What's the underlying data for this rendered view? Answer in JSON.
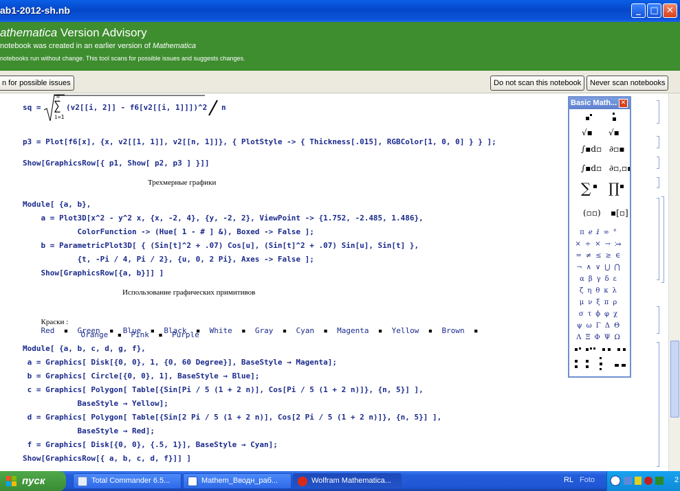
{
  "window": {
    "title": "ab1-2012-sh.nb"
  },
  "advisory": {
    "title_italic": "athematica",
    "title_rest": " Version Advisory",
    "line1_prefix": "notebook was created in an earlier version of ",
    "line1_italic": "Mathematica",
    "line2": "notebooks run without change. This tool scans for possible issues and suggests changes."
  },
  "buttons": {
    "scan": "n for possible issues",
    "do_not_scan": "Do not scan this notebook",
    "never_scan": "Never scan notebooks"
  },
  "code": {
    "sq": "sq = ",
    "sq_sum": "(v2[[i, 2]] - f6[v2[[i, 1]]])^2",
    "sq_div": "n",
    "sum_top": "n",
    "sum_bottom": "i=1",
    "p3": "p3 = Plot[f6[x], {x, v2[[1, 1]], v2[[n, 1]]}, { PlotStyle -> { Thickness[.015], RGBColor[1, 0, 0] } } ];",
    "show1": "Show[GraphicsRow[{ p1, Show[ p2, p3 ] }]]",
    "heading3d": "Трехмерные графики",
    "mod1_l1": "Module[ {a, b},",
    "mod1_l2": "    a = Plot3D[x^2 - y^2 x, {x, -2, 4}, {y, -2, 2}, ViewPoint -> {1.752, -2.485, 1.486},",
    "mod1_l3": "            ColorFunction -> (Hue[ 1 - # ] &), Boxed -> False ];",
    "mod1_l4": "    b = ParametricPlot3D[ { (Sin[t]^2 + .07) Cos[u], (Sin[t]^2 + .07) Sin[u], Sin[t] },",
    "mod1_l5": "            {t, -Pi / 4, Pi / 2}, {u, 0, 2 Pi}, Axes -> False ];",
    "mod1_l6": "    Show[GraphicsRow[{a, b}]] ]",
    "heading_prims": "Использование графических примитивов",
    "colors_label": "Краски :",
    "colors_row1": [
      "Red",
      "Green",
      "Blue",
      "Black",
      "White",
      "Gray",
      "Cyan",
      "Magenta",
      "Yellow",
      "Brown"
    ],
    "colors_row2": [
      "Orange",
      "Pink",
      "Purple"
    ],
    "mod2_l1": "Module[ {a, b, c, d, g, f},",
    "mod2_l2": " a = Graphics[ Disk[{0, 0}, 1, {0, 60 Degree}], BaseStyle → Magenta];",
    "mod2_l3": " b = Graphics[ Circle[{0, 0}, 1], BaseStyle → Blue];",
    "mod2_l4": " c = Graphics[ Polygon[ Table[{Sin[Pi / 5 (1 + 2 n)], Cos[Pi / 5 (1 + 2 n)]}, {n, 5}] ],",
    "mod2_l5": "            BaseStyle → Yellow];",
    "mod2_l6": " d = Graphics[ Polygon[ Table[{Sin[2 Pi / 5 (1 + 2 n)], Cos[2 Pi / 5 (1 + 2 n)]}, {n, 5}] ],",
    "mod2_l7": "            BaseStyle → Red];",
    "mod2_l8": " f = Graphics[ Disk[{0, 0}, {.5, 1}], BaseStyle → Cyan];",
    "mod2_l9": "Show[GraphicsRow[{ a, b, c, d, f}]] ]"
  },
  "palette": {
    "title": "Basic Math...",
    "greek_rows": [
      "πℯⅈ∞°",
      "×÷×→⧴",
      "=≠≤≥∈",
      "¬∧∨⋃⋂",
      "αβγδε",
      "ζηθκλ",
      "μνξπρ",
      "στϕφχ",
      "ψωΓΔΘ",
      "ΛΞΦΨΩ"
    ]
  },
  "taskbar": {
    "start": "пуск",
    "tasks": [
      "Total Commander 6.5...",
      "Mathem_Вводн_раб...",
      "Wolfram Mathematica..."
    ],
    "tray_lang": "RL",
    "tray_foto": "Foto",
    "tray_time": "2"
  }
}
